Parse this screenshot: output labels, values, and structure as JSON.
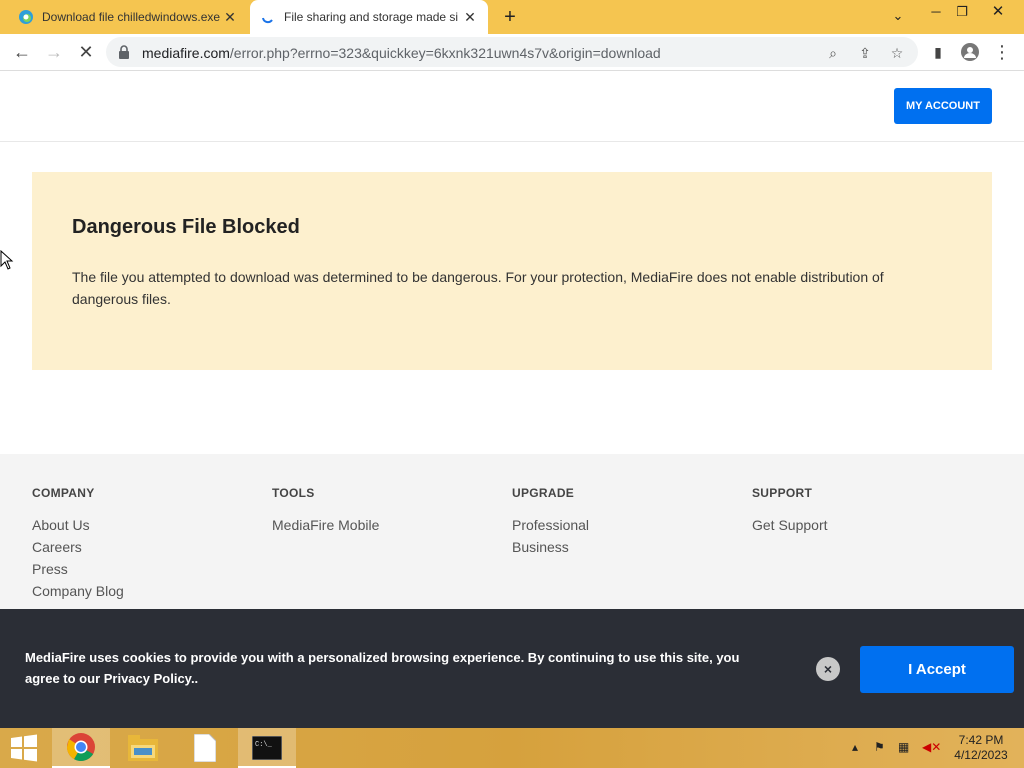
{
  "browser": {
    "tabs": [
      {
        "title": "Download file chilledwindows.exe",
        "active": false
      },
      {
        "title": "File sharing and storage made si",
        "active": true
      }
    ],
    "url_host": "mediafire.com",
    "url_rest": "/error.php?errno=323&quickkey=6kxnk321uwn4s7v&origin=download"
  },
  "header": {
    "my_account_label": "MY ACCOUNT"
  },
  "alert": {
    "title": "Dangerous File Blocked",
    "message": "The file you attempted to download was determined to be dangerous. For your protection, MediaFire does not enable distribution of dangerous files."
  },
  "footer": {
    "columns": [
      {
        "heading": "COMPANY",
        "links": [
          "About Us",
          "Careers",
          "Press",
          "Company Blog"
        ]
      },
      {
        "heading": "TOOLS",
        "links": [
          "MediaFire Mobile"
        ]
      },
      {
        "heading": "UPGRADE",
        "links": [
          "Professional",
          "Business"
        ]
      },
      {
        "heading": "SUPPORT",
        "links": [
          "Get Support"
        ]
      }
    ]
  },
  "cookie": {
    "message": "MediaFire uses cookies to provide you with a personalized browsing experience. By continuing to use this site, you agree to our Privacy Policy..",
    "accept_label": "I Accept",
    "close_glyph": "×"
  },
  "taskbar": {
    "time": "7:42 PM",
    "date": "4/12/2023",
    "apps": [
      "start-icon",
      "chrome-icon",
      "file-explorer-icon",
      "notepad-icon",
      "command-prompt-icon"
    ]
  },
  "colors": {
    "accent": "#0070f0",
    "alert_bg": "#fdf0ce",
    "cookie_bg": "#2b2e36",
    "tabstrip": "#f5c550"
  }
}
